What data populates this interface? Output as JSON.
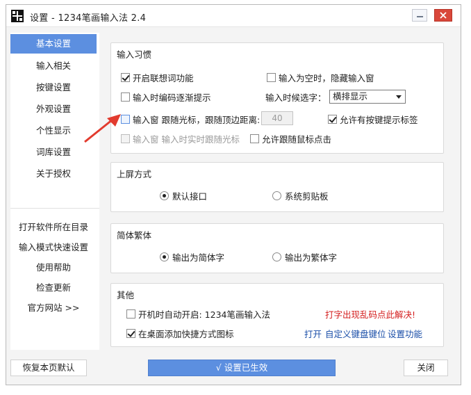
{
  "window": {
    "title": "设置 - 1234笔画输入法 2.4",
    "minimize_label": "minimize",
    "close_label": "close"
  },
  "sidebar": {
    "items": [
      {
        "label": "基本设置",
        "active": true
      },
      {
        "label": "输入相关"
      },
      {
        "label": "按键设置"
      },
      {
        "label": "外观设置"
      },
      {
        "label": "个性显示"
      },
      {
        "label": "词库设置"
      },
      {
        "label": "关于授权"
      }
    ],
    "links": [
      {
        "label": "打开软件所在目录"
      },
      {
        "label": "输入模式快速设置"
      },
      {
        "label": "使用帮助"
      },
      {
        "label": "检查更新"
      },
      {
        "label": "官方网站 >>"
      }
    ]
  },
  "habits": {
    "title": "输入习惯",
    "enable_association": "开启联想词功能",
    "hide_when_empty": "输入为空时，隐藏输入窗",
    "code_hint": "输入时编码逐渐提示",
    "candidate_label": "输入时候选字：",
    "candidate_value": "横排显示",
    "follow_cursor": "输入窗 跟随光标，跟随顶边距离:",
    "follow_distance": "40",
    "allow_key_hint": "允许有按键提示标签",
    "realtime_follow": "输入窗 输入时实时跟随光标",
    "allow_mouse_click": "允许跟随鼠标点击"
  },
  "commit": {
    "title": "上屏方式",
    "default_interface": "默认接口",
    "clipboard": "系统剪贴板"
  },
  "charset": {
    "title": "简体繁体",
    "simplified": "输出为简体字",
    "traditional": "输出为繁体字"
  },
  "other": {
    "title": "其他",
    "autostart": "开机时自动开启: 1234笔画输入法",
    "garbled_fix": "打字出现乱码点此解决!",
    "desktop_shortcut": "在桌面添加快捷方式图标",
    "open_link": "打开",
    "custom_key": "自定义键盘键位",
    "settings_feature": "设置功能"
  },
  "footer": {
    "restore": "恢复本页默认",
    "applied": "√  设置已生效",
    "close": "关闭"
  },
  "colors": {
    "accent": "#5c8fe0",
    "close_red": "#d9473b",
    "warning_text": "#d42020",
    "link_blue": "#1a4ea8"
  }
}
